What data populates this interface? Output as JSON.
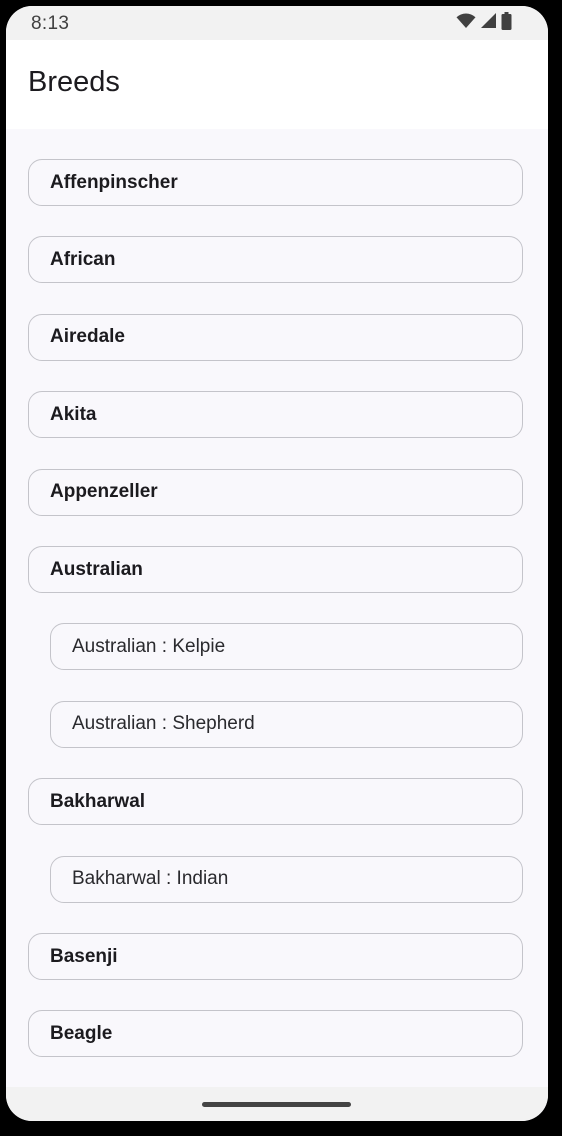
{
  "status_bar": {
    "time": "8:13",
    "icons": [
      "wifi-icon",
      "cellular-signal-icon",
      "battery-icon"
    ]
  },
  "app_bar": {
    "title": "Breeds"
  },
  "breed_list": [
    {
      "label": "Affenpinscher",
      "level": "breed"
    },
    {
      "label": "African",
      "level": "breed"
    },
    {
      "label": "Airedale",
      "level": "breed"
    },
    {
      "label": "Akita",
      "level": "breed"
    },
    {
      "label": "Appenzeller",
      "level": "breed"
    },
    {
      "label": "Australian",
      "level": "breed"
    },
    {
      "label": "Australian : Kelpie",
      "level": "sub-breed"
    },
    {
      "label": "Australian : Shepherd",
      "level": "sub-breed"
    },
    {
      "label": "Bakharwal",
      "level": "breed"
    },
    {
      "label": "Bakharwal : Indian",
      "level": "sub-breed"
    },
    {
      "label": "Basenji",
      "level": "breed"
    },
    {
      "label": "Beagle",
      "level": "breed"
    },
    {
      "label": "",
      "level": "breed"
    }
  ],
  "colors": {
    "background": "#f9f8fc",
    "row_border": "#c4c4ca",
    "text": "#1c1b1f",
    "status_bar": "#f2f2f2"
  }
}
